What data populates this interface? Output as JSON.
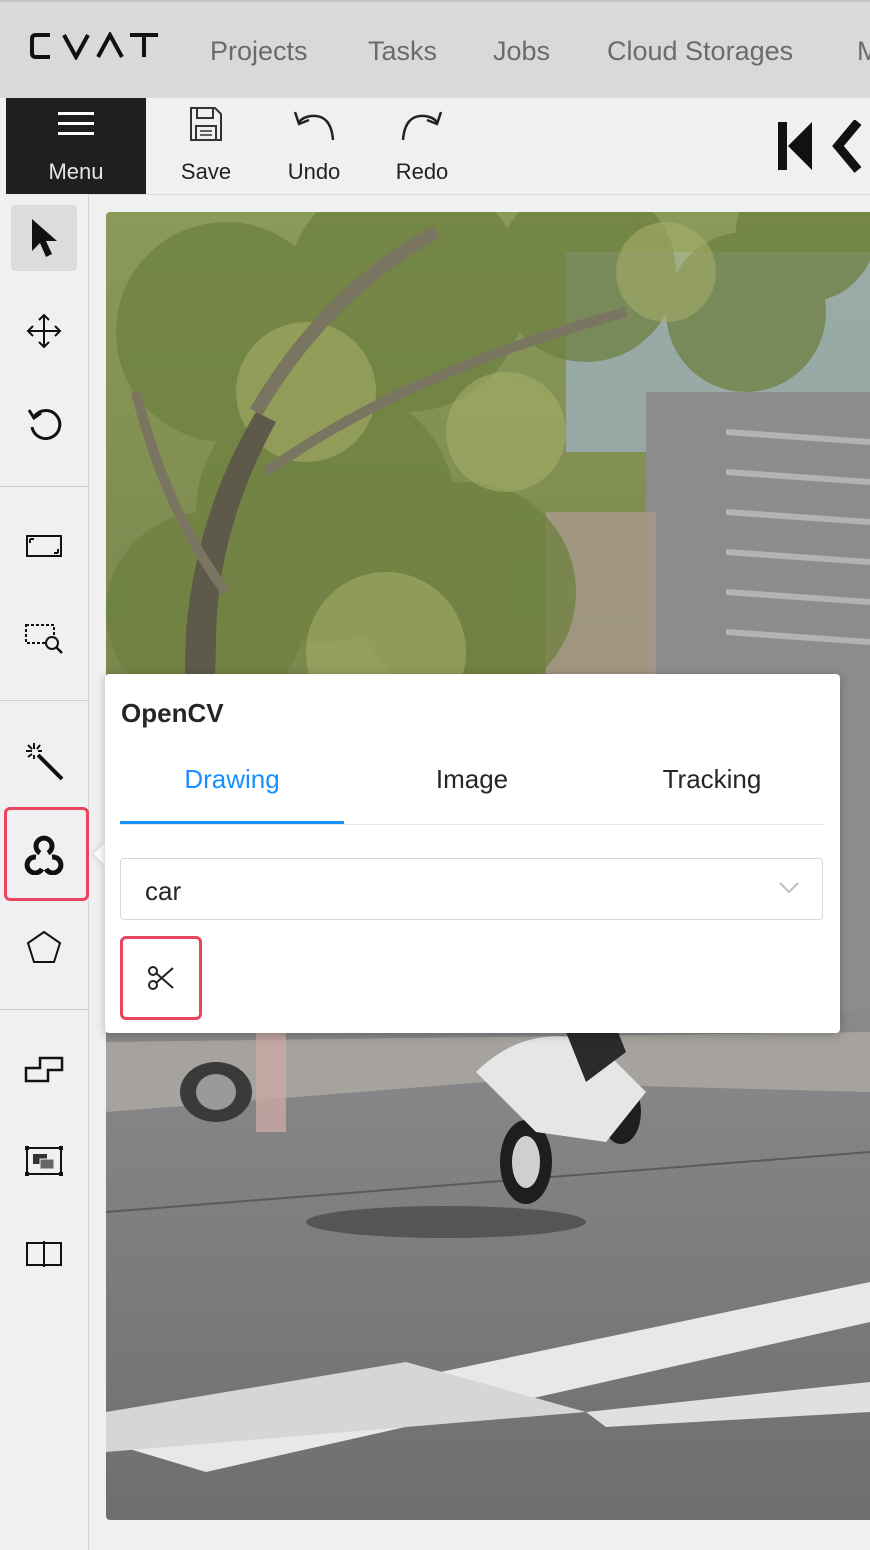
{
  "header": {
    "logo_text": "CVAT",
    "nav": [
      "Projects",
      "Tasks",
      "Jobs",
      "Cloud Storages",
      "M"
    ]
  },
  "toolbar": {
    "menu_label": "Menu",
    "save_label": "Save",
    "undo_label": "Undo",
    "redo_label": "Redo"
  },
  "sidebar": {
    "tools": [
      "cursor-icon",
      "move-icon",
      "rotate-icon",
      "rectangle-fit-icon",
      "zoom-region-icon",
      "ai-tools-wand-icon",
      "opencv-icon",
      "polygon-icon",
      "merge-shapes-icon",
      "group-shapes-icon",
      "split-track-icon"
    ],
    "active": "cursor-icon",
    "highlighted": "opencv-icon",
    "highlight_color": "#e94561"
  },
  "opencv_popover": {
    "title": "OpenCV",
    "tabs": [
      "Drawing",
      "Image",
      "Tracking"
    ],
    "active_tab": "Drawing",
    "label_select_value": "car",
    "tool_button_icon": "scissors-icon",
    "accent_color": "#1890ff"
  }
}
